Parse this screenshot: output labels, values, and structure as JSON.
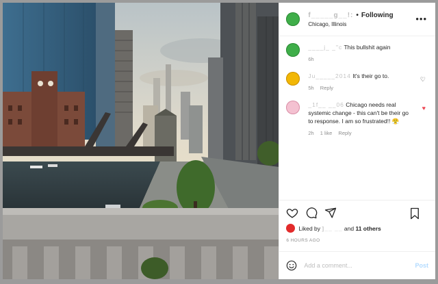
{
  "post": {
    "author": "f_____g__!:",
    "separator": "•",
    "follow_label": "Following",
    "location": "Chicago, Illinois"
  },
  "comments": [
    {
      "user": "____j_ _\"c",
      "text": "This bullshit again",
      "time": "6h",
      "likes": "",
      "reply": "",
      "avatar_color": "#3fae49"
    },
    {
      "user": "Ju_____2014",
      "text": "It's their go to.",
      "time": "5h",
      "likes": "",
      "reply": "Reply",
      "avatar_color": "#f2b705"
    },
    {
      "user": "_1f__ __06",
      "text": "Chicago needs real systemic change - this can't be their go to response. I am so frustrated!! 😤",
      "time": "2h",
      "likes": "1 like",
      "reply": "Reply",
      "avatar_color": "#f4c1d1"
    }
  ],
  "actions": {
    "liked_by_prefix": "Liked by",
    "liked_by_user": "]__ __",
    "liked_by_suffix": "and",
    "others": "11 others",
    "timestamp": "6 HOURS AGO"
  },
  "add_comment": {
    "placeholder": "Add a comment...",
    "post_label": "Post"
  },
  "icons": [
    "heart-icon",
    "comment-icon",
    "share-icon",
    "bookmark-icon",
    "emoji-icon",
    "more-icon"
  ],
  "colors": {
    "accent": "#0095f6",
    "liked_heart": "#ed4956",
    "post_button": "#b3dbff"
  }
}
